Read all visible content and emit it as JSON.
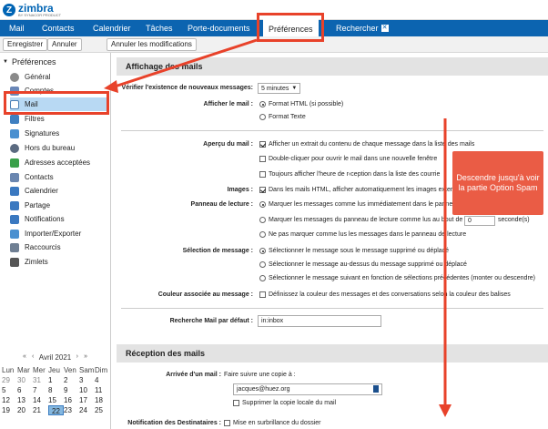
{
  "app": {
    "brand": "zimbra",
    "sub": "BY SYNACOR PRODUCT"
  },
  "nav": {
    "mail": "Mail",
    "contacts": "Contacts",
    "calendar": "Calendrier",
    "tasks": "Tâches",
    "docs": "Porte-documents",
    "prefs": "Préférences",
    "search": "Rechercher"
  },
  "toolbar": {
    "save": "Enregistrer",
    "cancel": "Annuler",
    "undo": "Annuler les modifications"
  },
  "sidebar": {
    "title": "Préférences",
    "items": [
      "Général",
      "Comptes",
      "Mail",
      "Filtres",
      "Signatures",
      "Hors du bureau",
      "Adresses acceptées",
      "Contacts",
      "Calendrier",
      "Partage",
      "Notifications",
      "Importer/Exporter",
      "Raccourcis",
      "Zimlets"
    ]
  },
  "calendar": {
    "title": "Avril 2021",
    "weekdays": [
      "Lun",
      "Mar",
      "Mer",
      "Jeu",
      "Ven",
      "Sam",
      "Dim"
    ],
    "rows": [
      [
        "29",
        "30",
        "31",
        "1",
        "2",
        "3",
        "4"
      ],
      [
        "5",
        "6",
        "7",
        "8",
        "9",
        "10",
        "11"
      ],
      [
        "12",
        "13",
        "14",
        "15",
        "16",
        "17",
        "18"
      ],
      [
        "19",
        "20",
        "21",
        "22",
        "23",
        "24",
        "25"
      ]
    ],
    "today": "22"
  },
  "sections": {
    "display": "Affichage des mails",
    "receive": "Réception des mails"
  },
  "check": {
    "label": "Vérifier l'existence de nouveaux messages:",
    "value": "5 minutes"
  },
  "show": {
    "label": "Afficher le mail :",
    "opt1": "Format HTML (si possible)",
    "opt2": "Format Texte"
  },
  "preview": {
    "label": "Aperçu du mail :",
    "opt1": "Afficher un extrait du contenu de chaque message dans la liste des mails",
    "opt2": "Double-cliquer pour ouvrir le mail dans une nouvelle fenêtre",
    "opt3": "Toujours afficher l'heure de r‹ception dans la liste des courrie"
  },
  "images": {
    "label": "Images :",
    "opt1": "Dans les mails HTML, afficher automatiquement les images extern"
  },
  "reading": {
    "label": "Panneau de lecture :",
    "opt1": "Marquer les messages comme lus immédiatement dans le panneau",
    "opt2": "Marquer les messages du panneau de lecture comme lus au bout de",
    "seconds": "0",
    "unit": "seconde(s)",
    "opt3": "Ne pas marquer comme lus les messages dans le panneau de lecture"
  },
  "selection": {
    "label": "Sélection de message :",
    "opt1": "Sélectionner le message sous le message supprimé ou déplacé",
    "opt2": "Sélectionner le message au-dessus du message supprimé ou déplacé",
    "opt3": "Sélectionner le message suivant en fonction de sélections précédentes (monter ou descendre)"
  },
  "color": {
    "label": "Couleur associée au message :",
    "opt1": "Définissez la couleur des messages et des conversations selon la couleur des balises"
  },
  "search": {
    "label": "Recherche Mail par défaut :",
    "value": "in:inbox"
  },
  "arrival": {
    "label": "Arrivée d'un mail :",
    "text": "Faire suivre une copie à :",
    "value": "jacques@huez.org",
    "opt1": "Supprimer la copie locale du mail"
  },
  "notif": {
    "label": "Notification des Destinataires :",
    "text": "Mise en surbrillance du dossier"
  },
  "callout": "Descendre jusqu'à voir la partie Option Spam",
  "colors": {
    "nav": "#0c64b0",
    "accent": "#e8422a",
    "callout": "#ea5c45",
    "today": "#85b8e0"
  }
}
